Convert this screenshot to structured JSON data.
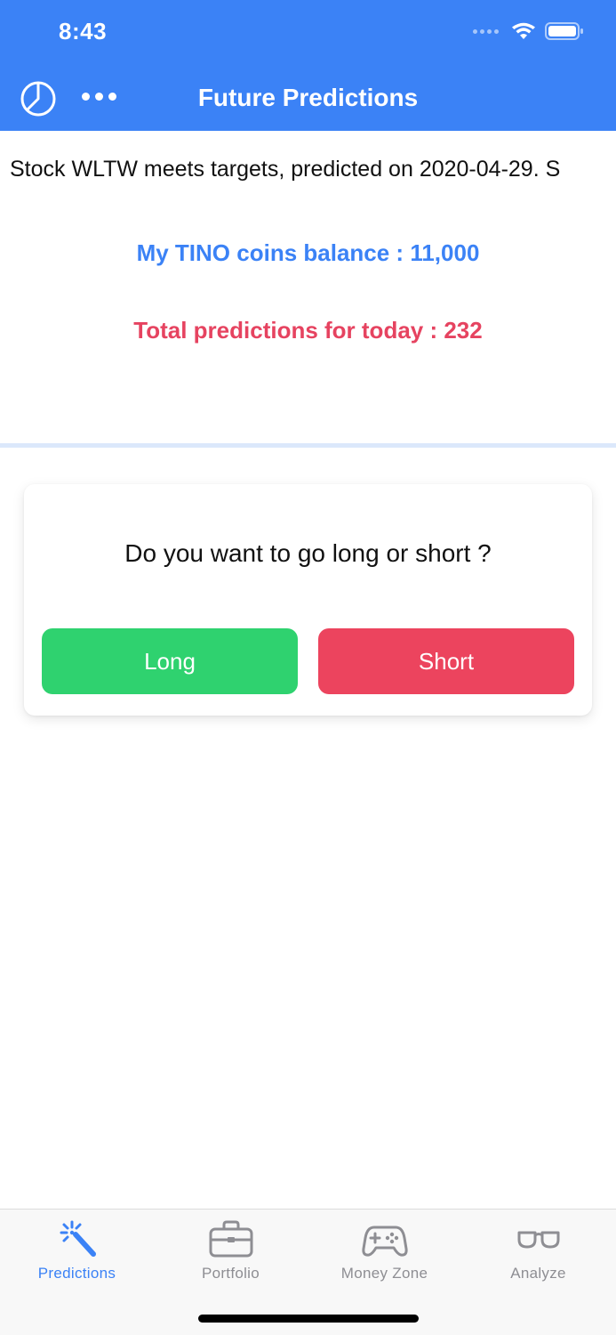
{
  "status_bar": {
    "time": "8:43"
  },
  "header": {
    "title": "Future Predictions",
    "background_color": "#3b82f6",
    "left_icon": "pie-chart-icon",
    "menu_icon": "more-dots-icon"
  },
  "ticker": {
    "text": "Stock WLTW meets targets, predicted on 2020-04-29. S"
  },
  "stats": {
    "balance_label": "My TINO coins balance : 11,000",
    "total_label": "Total predictions for today : 232",
    "balance_color": "#3b82f6",
    "total_color": "#e64360"
  },
  "prompt_card": {
    "question": "Do you want to go long or short ?",
    "long_label": "Long",
    "short_label": "Short",
    "long_color": "#2fd26f",
    "short_color": "#ec445e"
  },
  "tabbar": {
    "active_color": "#3b82f6",
    "items": [
      {
        "label": "Predictions",
        "icon": "magic-wand-icon",
        "active": true
      },
      {
        "label": "Portfolio",
        "icon": "briefcase-icon",
        "active": false
      },
      {
        "label": "Money Zone",
        "icon": "gamepad-icon",
        "active": false
      },
      {
        "label": "Analyze",
        "icon": "glasses-icon",
        "active": false
      }
    ]
  }
}
